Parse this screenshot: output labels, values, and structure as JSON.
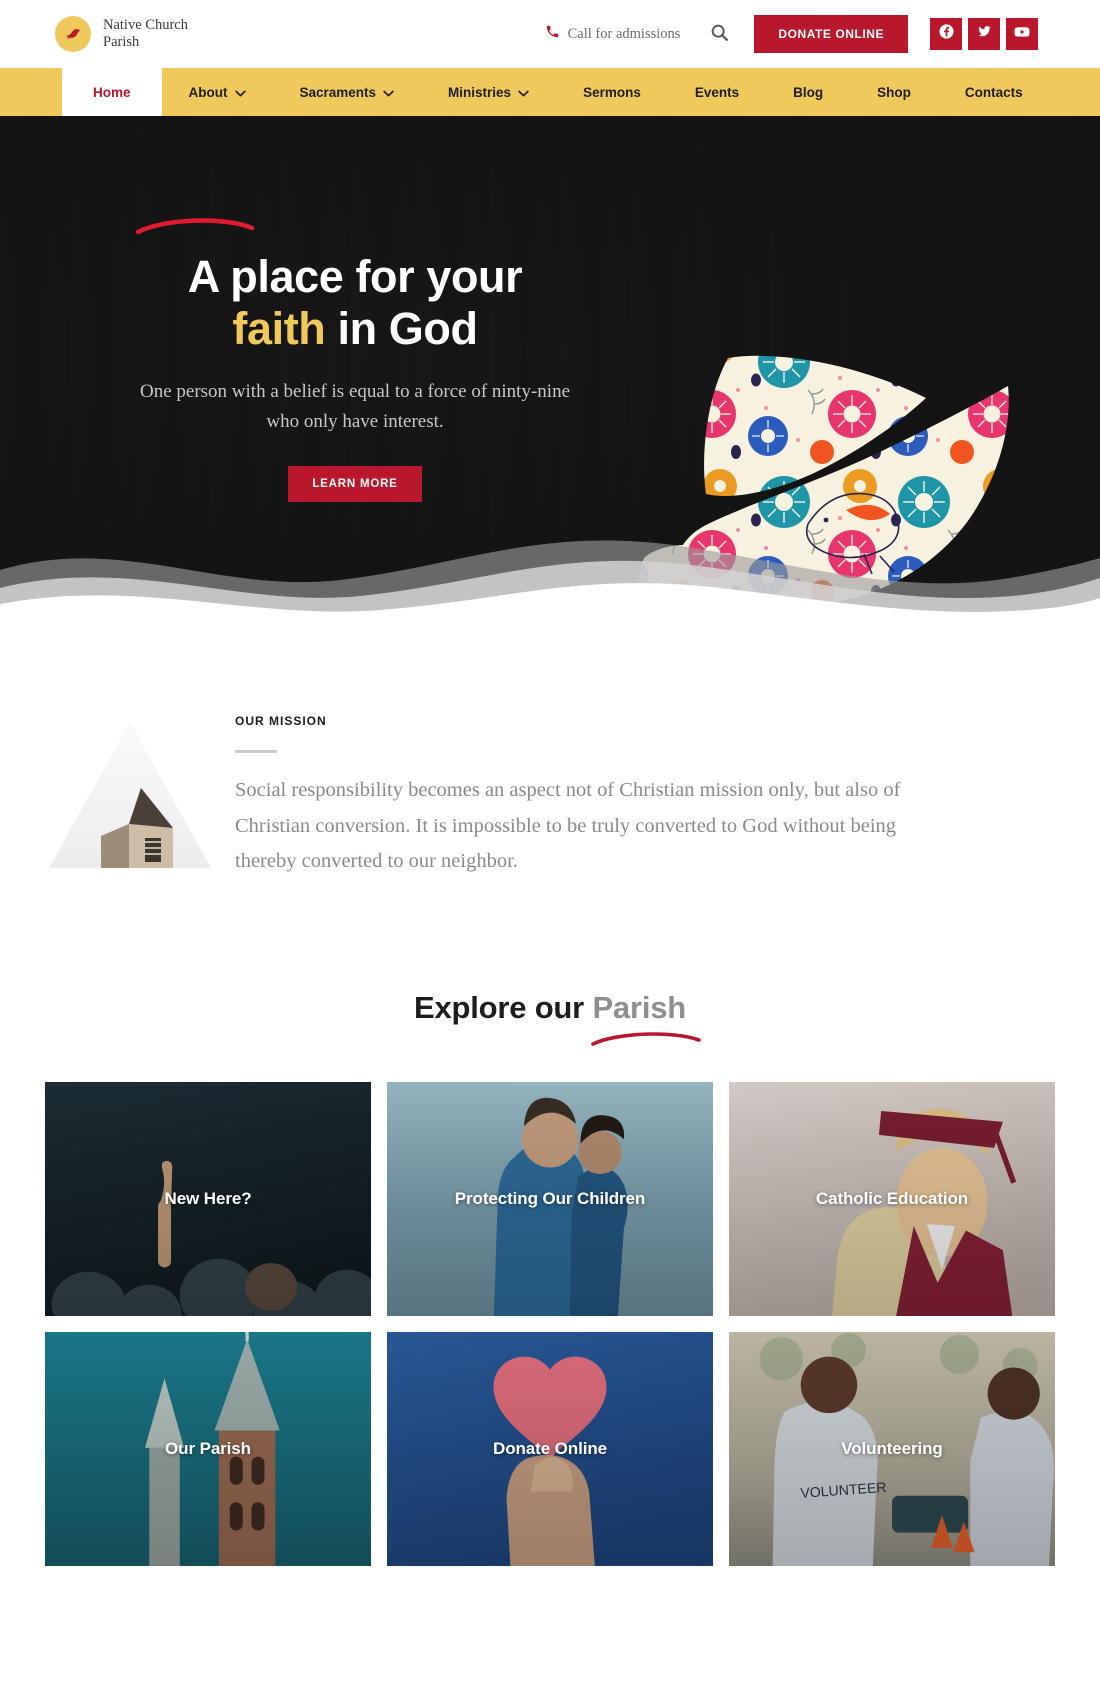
{
  "topbar": {
    "brand_name": "Native Church\nParish",
    "logo_icon": "dove-logo-icon",
    "phone_icon": "phone-icon",
    "call_text": "Call for admissions",
    "search_icon": "search-icon",
    "donate_label": "DONATE ONLINE",
    "socials": [
      {
        "name": "facebook",
        "icon": "facebook-icon"
      },
      {
        "name": "twitter",
        "icon": "twitter-icon"
      },
      {
        "name": "youtube",
        "icon": "youtube-icon"
      }
    ]
  },
  "nav": {
    "items": [
      {
        "label": "Home",
        "active": true,
        "dropdown": false
      },
      {
        "label": "About",
        "active": false,
        "dropdown": true
      },
      {
        "label": "Sacraments",
        "active": false,
        "dropdown": true
      },
      {
        "label": "Ministries",
        "active": false,
        "dropdown": true
      },
      {
        "label": "Sermons",
        "active": false,
        "dropdown": false
      },
      {
        "label": "Events",
        "active": false,
        "dropdown": false
      },
      {
        "label": "Blog",
        "active": false,
        "dropdown": false
      },
      {
        "label": "Shop",
        "active": false,
        "dropdown": false
      },
      {
        "label": "Contacts",
        "active": false,
        "dropdown": false
      }
    ]
  },
  "hero": {
    "title_line1": "A place for your",
    "title_accent": "faith",
    "title_rest": " in God",
    "subtitle": "One person with a belief is equal to a force of ninty-nine who only have interest.",
    "cta_label": "LEARN MORE",
    "graphic": "floral-dove-illustration"
  },
  "mission": {
    "kicker": "OUR MISSION",
    "text": "Social responsibility becomes an aspect not of Christian mission only, but also of Christian conversion. It is impossible to be truly converted to God without being thereby converted to our neighbor.",
    "art": "church-photo-triangle"
  },
  "explore": {
    "title_main": "Explore our ",
    "title_muted": "Parish",
    "cards": [
      {
        "label": "New Here?",
        "image": "crowd-worship-photo"
      },
      {
        "label": "Protecting Our Children",
        "image": "father-and-child-photo"
      },
      {
        "label": "Catholic Education",
        "image": "graduate-student-photo"
      },
      {
        "label": "Our Parish",
        "image": "church-steeples-photo"
      },
      {
        "label": "Donate Online",
        "image": "hand-holding-heart-photo"
      },
      {
        "label": "Volunteering",
        "image": "volunteers-cleanup-photo"
      }
    ]
  },
  "colors": {
    "brand_red": "#b9172c",
    "brand_gold": "#f0c95c",
    "nav_text": "#1f1f1f",
    "muted_text": "#8a8a8a"
  }
}
